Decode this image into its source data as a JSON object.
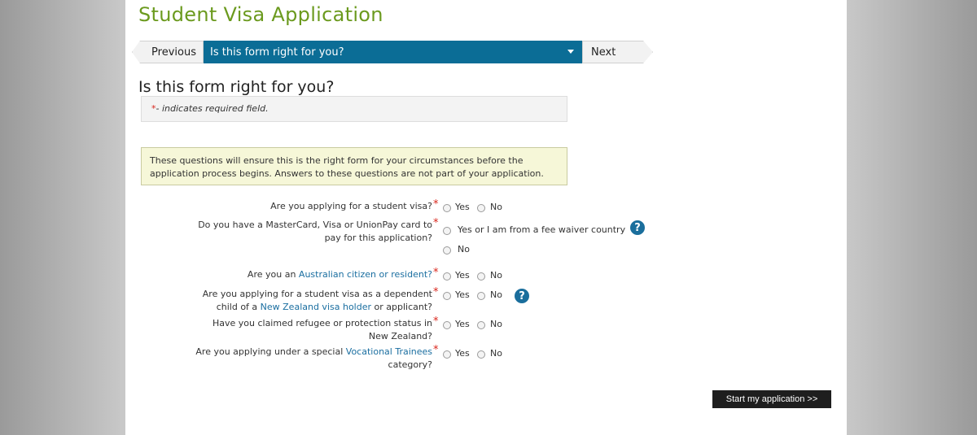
{
  "header": {
    "title": "Student Visa Application"
  },
  "nav": {
    "previous_label": "Previous",
    "current_step": "Is this form right for you?",
    "next_label": "Next"
  },
  "section": {
    "heading": "Is this form right for you?",
    "required_star": "*",
    "required_note": "- indicates required field.",
    "info_line1": "These questions will ensure this is the right form for your circumstances before the",
    "info_line2": "application process begins. Answers to these questions are not part of your application."
  },
  "questions": {
    "q1": {
      "text": "Are you applying for a student visa?",
      "yes": "Yes",
      "no": "No"
    },
    "q2": {
      "line1": "Do you have a MasterCard, Visa or UnionPay card to",
      "line2": "pay for this application?",
      "yes": "Yes or I am from a fee waiver country",
      "no": "No"
    },
    "q3": {
      "pre": "Are you an ",
      "link": "Australian citizen or resident?",
      "yes": "Yes",
      "no": "No"
    },
    "q4": {
      "line1": "Are you applying for a student visa as a dependent",
      "line2_pre": "child of a ",
      "line2_link": "New Zealand visa holder",
      "line2_post": " or applicant?",
      "yes": "Yes",
      "no": "No"
    },
    "q5": {
      "line1": "Have you claimed refugee or protection status in",
      "line2": "New Zealand?",
      "yes": "Yes",
      "no": "No"
    },
    "q6": {
      "line1_pre": "Are you applying under a special ",
      "line1_link": "Vocational Trainees",
      "line2": "category?",
      "yes": "Yes",
      "no": "No"
    }
  },
  "help_glyph": "?",
  "start_button": "Start my application >>",
  "colors": {
    "title_green": "#6b9a1e",
    "nav_blue": "#0b6d96",
    "link_blue": "#1a6ea0",
    "required_red": "#d9261c"
  }
}
